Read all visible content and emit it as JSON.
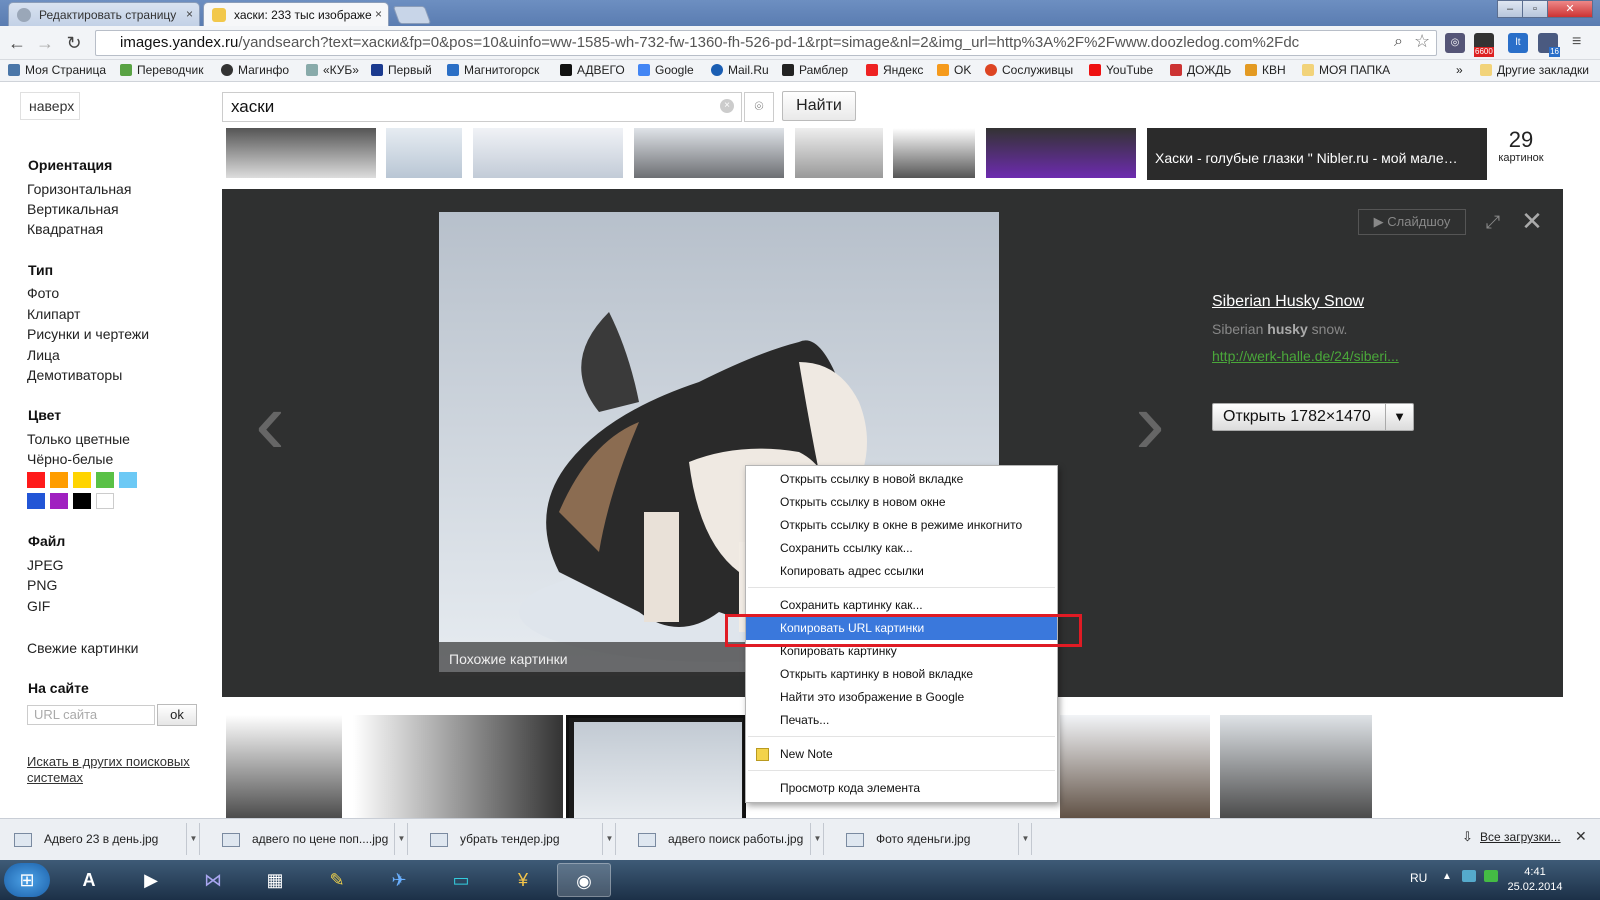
{
  "browser": {
    "tabs": [
      {
        "label": "Редактировать страницу",
        "active": false
      },
      {
        "label": "хаски: 233 тыс изображе",
        "active": true
      }
    ],
    "address": {
      "host": "images.yandex.ru",
      "path": "/yandsearch?text=хаски&fp=0&pos=10&uinfo=ww-1585-wh-732-fw-1360-fh-526-pd-1&rpt=simage&nl=2&img_url=http%3A%2F%2Fwww.doozledog.com%2Fdc"
    },
    "ext_badges": {
      "mail": "6600",
      "mail2": "16"
    },
    "bookmarks": [
      "Моя Страница",
      "Переводчик",
      "Магинфо",
      "«КУБ»",
      "Первый",
      "Магнитогорск",
      "АДВЕГО",
      "Google",
      "Mail.Ru",
      "Рамблер",
      "Яндекс",
      "OK",
      "Сослуживцы",
      "YouTube",
      "ДОЖДЬ",
      "КВН",
      "МОЯ ПАПКА"
    ],
    "bookmarks_more": "»",
    "other_bookmarks": "Другие закладки"
  },
  "page": {
    "top_button": "наверх",
    "search": {
      "value": "хаски",
      "button": "Найти"
    },
    "sidebar": {
      "orientation": {
        "heading": "Ориентация",
        "items": [
          "Горизонтальная",
          "Вертикальная",
          "Квадратная"
        ]
      },
      "type": {
        "heading": "Тип",
        "items": [
          "Фото",
          "Клипарт",
          "Рисунки и чертежи",
          "Лица",
          "Демотиваторы"
        ]
      },
      "color": {
        "heading": "Цвет",
        "items": [
          "Только цветные",
          "Чёрно-белые"
        ],
        "swatches": [
          "#ff1a1a",
          "#ff9d00",
          "#ffd400",
          "#5ac146",
          "#6cc9f5",
          "#2255d6",
          "#a020c0",
          "#000000",
          "#ffffff"
        ]
      },
      "file": {
        "heading": "Файл",
        "items": [
          "JPEG",
          "PNG",
          "GIF"
        ]
      },
      "fresh": "Свежие картинки",
      "site": {
        "heading": "На сайте",
        "placeholder": "URL сайта",
        "button": "ok"
      },
      "other_engines": "Искать в других поисковых системах"
    },
    "strip": {
      "title": "Хаски - голубые глазки \" Nibler.ru - мой мале…",
      "count": "29",
      "count_label": "картинок"
    },
    "viewer": {
      "slideshow": "Слайдшоу",
      "title": "Siberian Husky Snow",
      "desc_pre": "Siberian ",
      "desc_bold": "husky",
      "desc_post": " snow.",
      "link": "http://werk-halle.de/24/siberi...",
      "open_button": "Открыть 1782×1470",
      "similar": "Похожие картинки"
    }
  },
  "context_menu": {
    "groups": [
      [
        "Открыть ссылку в новой вкладке",
        "Открыть ссылку в новом окне",
        "Открыть ссылку в окне в режиме инкогнито",
        "Сохранить ссылку как...",
        "Копировать адрес ссылки"
      ],
      [
        "Сохранить картинку как...",
        "Копировать URL картинки",
        "Копировать картинку",
        "Открыть картинку в новой вкладке",
        "Найти это изображение в Google",
        "Печать..."
      ],
      [
        "New Note"
      ],
      [
        "Просмотр кода элемента"
      ]
    ],
    "highlighted": "Копировать URL картинки"
  },
  "downloads": {
    "items": [
      "Адвего 23 в день.jpg",
      "адвего по цене поп....jpg",
      "убрать тендер.jpg",
      "адвего поиск работы.jpg",
      "Фото яденьги.jpg"
    ],
    "all": "Все загрузки..."
  },
  "taskbar": {
    "lang": "RU",
    "time": "4:41",
    "date": "25.02.2014"
  },
  "colors": {
    "viewer_bg": "#2f3030",
    "menu_highlight": "#3a78dc",
    "annotation_box": "#e01b24",
    "link_green": "#4aa73a"
  }
}
